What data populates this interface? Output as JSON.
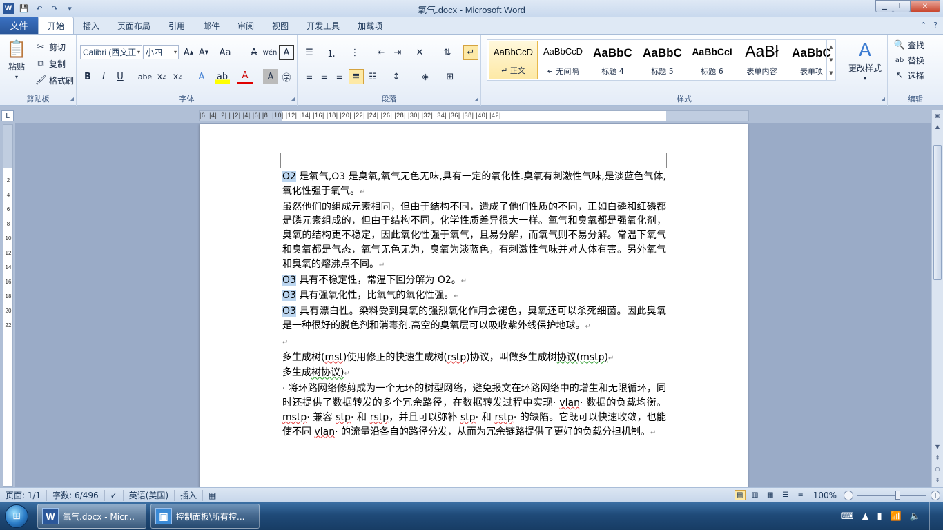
{
  "window": {
    "title": "氧气.docx - Microsoft Word",
    "app_letter": "W"
  },
  "tabs": [
    "开始",
    "插入",
    "页面布局",
    "引用",
    "邮件",
    "审阅",
    "视图",
    "开发工具",
    "加载项"
  ],
  "file_tab": "文件",
  "clipboard": {
    "paste": "粘贴",
    "cut": "剪切",
    "copy": "复制",
    "format_painter": "格式刷",
    "label": "剪贴板"
  },
  "font": {
    "name": "Calibri (西文正",
    "size": "小四",
    "label": "字体"
  },
  "paragraph": {
    "label": "段落"
  },
  "styles": {
    "label": "样式",
    "items": [
      {
        "sample": "AaBbCcD",
        "name": "↵ 正文"
      },
      {
        "sample": "AaBbCcD",
        "name": "↵ 无间隔"
      },
      {
        "sample": "AaBbC",
        "name": "标题 4"
      },
      {
        "sample": "AaBbC",
        "name": "标题 5"
      },
      {
        "sample": "AaBbCcI",
        "name": "标题 6"
      },
      {
        "sample": "AaBł",
        "name": "表单内容"
      },
      {
        "sample": "AaBbC",
        "name": "表单项"
      }
    ],
    "change": "更改样式"
  },
  "editing": {
    "find": "查找",
    "replace": "替换",
    "select": "选择",
    "label": "编辑"
  },
  "ruler": {
    "h_numbers": "|6|  |4|  |2|  |  |2|  |4|  |6|  |8|  |10|  |12|  |14|  |16|  |18|  |20|  |22|  |24|  |26|  |28|  |30|  |32|  |34|  |36|  |38|  |40|  |42|",
    "v_numbers": [
      "2",
      "",
      "4",
      "",
      "6",
      "",
      "8",
      "",
      "10",
      "",
      "12",
      "",
      "14",
      "",
      "16",
      "",
      "18",
      "",
      "20",
      "",
      "22"
    ]
  },
  "document": {
    "p1a": "O2",
    "p1b": " 是氧气,O3 ",
    "p1c": "是臭氧,氧气无色无味,具有一定的氧化性.臭氧有刺激性气味,是淡蓝色气体,氧化性强于氧气。",
    "p2": "虽然他们的组成元素相同，但由于结构不同，造成了他们性质的不同，正如白磷和红磷都是磷元素组成的，但由于结构不同，化学性质差异很大一样。氧气和臭氧都是强氧化剂，臭氧的结构更不稳定，因此氧化性强于氧气，且易分解，而氧气则不易分解。常温下氧气和臭氧都是气态，氧气无色无为，臭氧为淡蓝色，有刺激性气味并对人体有害。另外氧气和臭氧的熔沸点不同。",
    "p3a": "O3",
    "p3b": " 具有不稳定性，常温下回分解为 O2。",
    "p4a": "O3",
    "p4b": " 具有强氧化性，比氧气的氧化性强。",
    "p5a": "O3",
    "p5b": " 具有漂白性。染料受到臭氧的强烈氧化作用会褪色，臭氧还可以杀死细菌。因此臭氧是一种很好的脱色剂和消毒剂.高空的臭氧层可以吸收紫外线保护地球。",
    "p7a": "多生成树(",
    "p7b": "mst",
    "p7c": ")使用修正的快速生成树(",
    "p7d": "rstp",
    "p7e": ")协议，叫做多生成树",
    "p7f": "协议(mstp)",
    "p8a": "多生成",
    "p8b": "树协议)",
    "p9a": "· 将环路网络修剪成为一个无环的树型网络，避免报文在环路网络中的增生和无限循环，同时还提供了数据转发的多个冗余路径，在数据转发过程中实现· ",
    "p9b": "vlan",
    "p9c": "· 数据的负载均衡。",
    "p9d": "mstp",
    "p9e": "· 兼容 ",
    "p9f": "stp",
    "p9g": "· 和 ",
    "p9h": "rstp",
    "p9i": "，并且可以弥补 ",
    "p9j": "stp",
    "p9k": "· 和 ",
    "p9l": "rstp",
    "p9m": "· 的缺陷。它既可以快速收敛，也能使不同 ",
    "p9n": "vlan",
    "p9o": "· 的流量沿各自的路径分发，从而为冗余链路提供了更好的负载分担机制。"
  },
  "status": {
    "page": "页面: 1/1",
    "words": "字数: 6/496",
    "lang": "英语(美国)",
    "mode": "插入",
    "zoom": "100%",
    "zoom_level": 100
  },
  "taskbar": {
    "tasks": [
      {
        "label": "氧气.docx - Micr..."
      },
      {
        "label": "控制面板\\所有控..."
      }
    ]
  }
}
